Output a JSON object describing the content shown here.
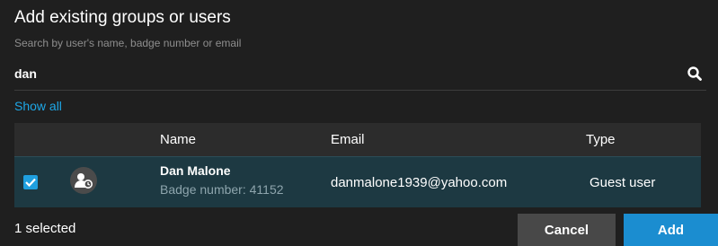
{
  "dialog": {
    "title": "Add existing groups or users",
    "subtitle": "Search by user's name, badge number or email"
  },
  "search": {
    "value": "dan",
    "icon": "search-icon"
  },
  "show_all_label": "Show all",
  "table": {
    "headers": {
      "name": "Name",
      "email": "Email",
      "type": "Type"
    },
    "rows": [
      {
        "checked": true,
        "avatar_icon": "guest-user-icon",
        "name": "Dan Malone",
        "badge": "Badge number: 41152",
        "email": "danmalone1939@yahoo.com",
        "type": "Guest user"
      }
    ]
  },
  "footer": {
    "selected_count": "1 selected",
    "cancel_label": "Cancel",
    "add_label": "Add"
  },
  "colors": {
    "accent": "#1ea7e6",
    "selected_row": "#1d3942",
    "add_button": "#1b8dd0"
  }
}
